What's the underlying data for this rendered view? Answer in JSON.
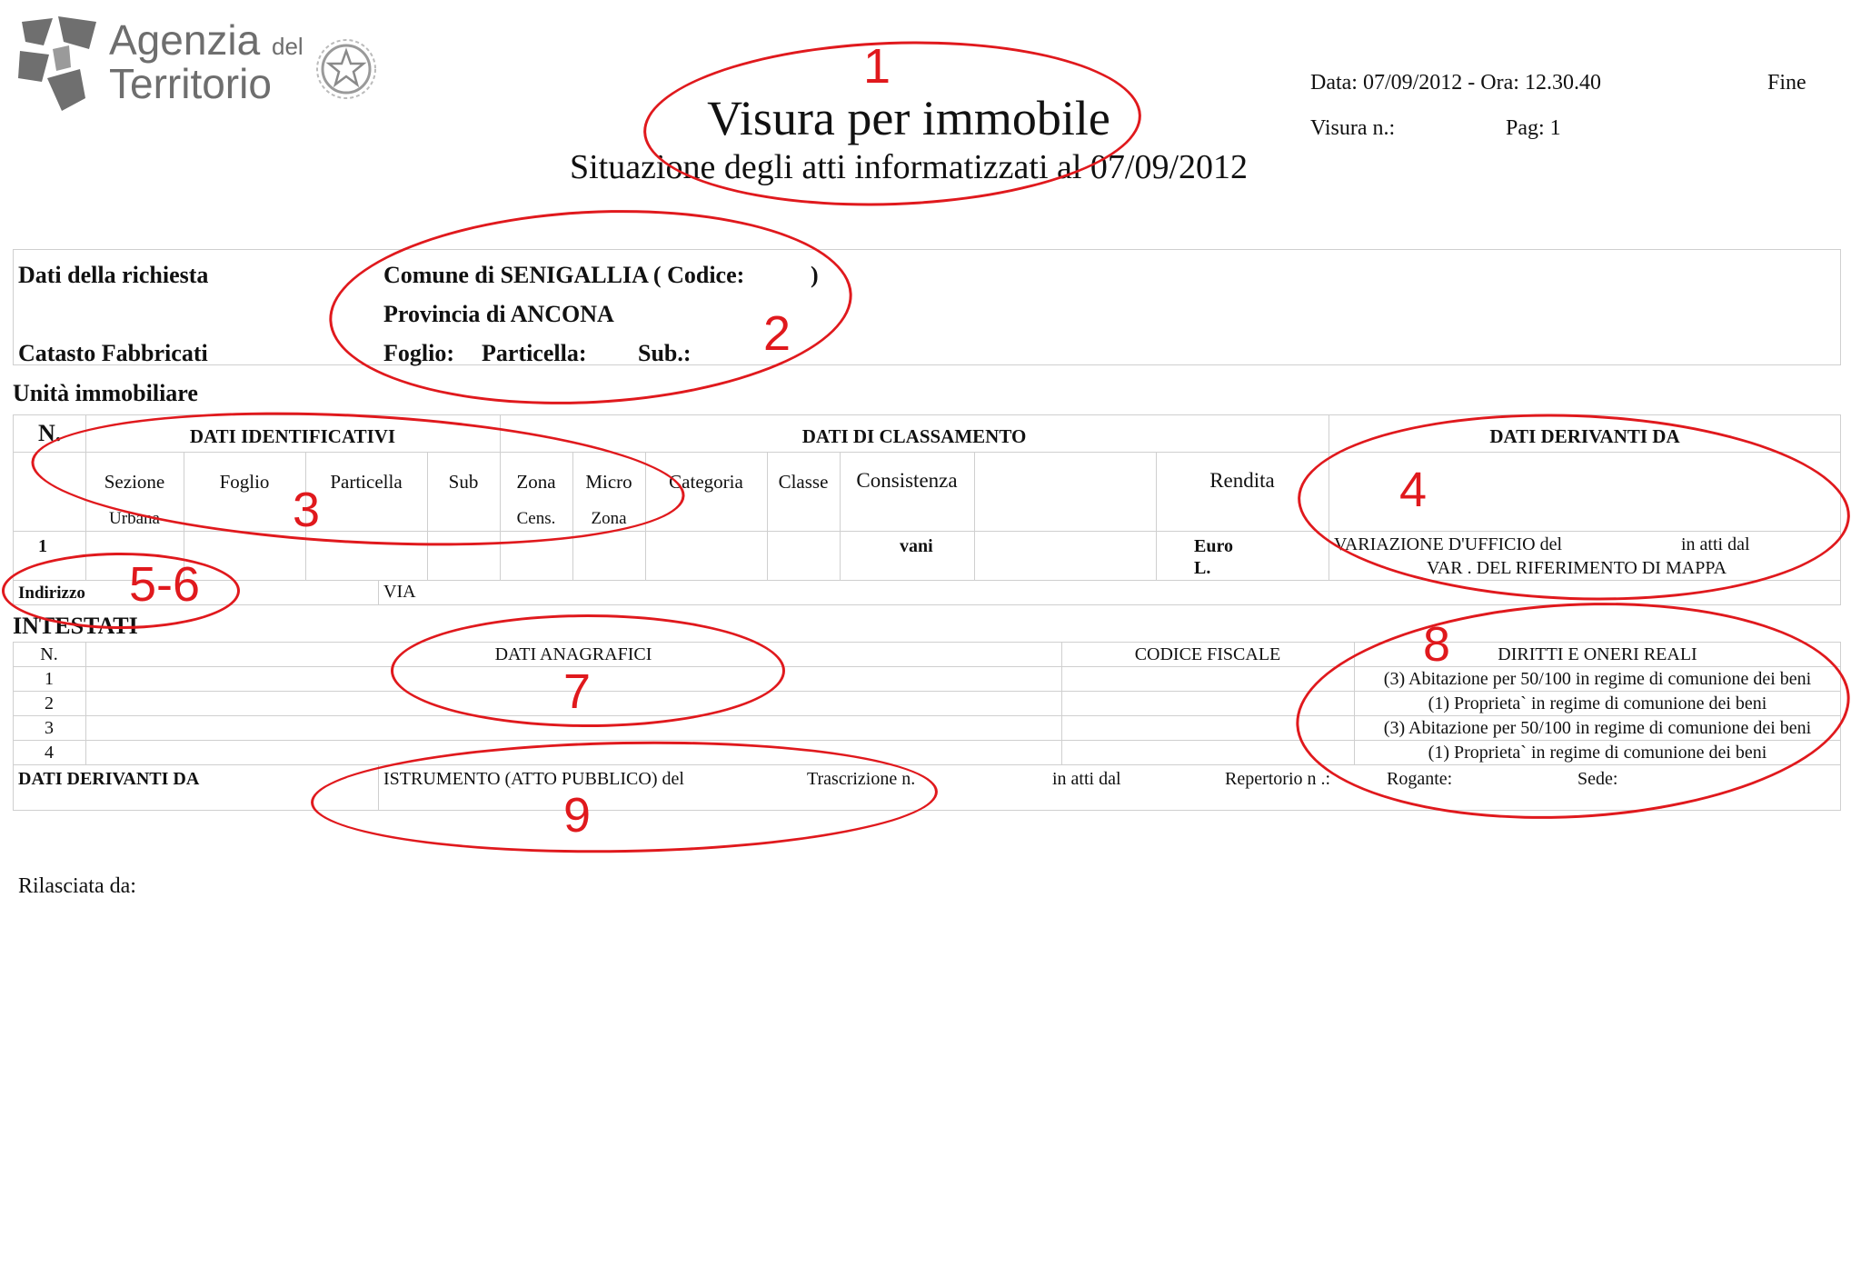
{
  "header": {
    "brand_line1": "Agenzia",
    "brand_del": "del",
    "brand_line2": "Territorio",
    "title": "Visura per immobile",
    "subtitle": "Situazione degli atti informatizzati al 07/09/2012",
    "date_line": "Data: 07/09/2012 - Ora: 12.30.40",
    "fine": "Fine",
    "visura_label": "Visura n.:",
    "pag_label": "Pag: 1"
  },
  "richiesta": {
    "label": "Dati della richiesta",
    "catasto": "Catasto Fabbricati",
    "comune": "Comune di SENIGALLIA ( Codice:",
    "comune_close": ")",
    "provincia": "Provincia di ANCONA",
    "foglio": "Foglio:",
    "particella": "Particella:",
    "sub": "Sub.:"
  },
  "unita": {
    "title": "Unità immobiliare",
    "n_header": "N.",
    "dati_identificativi": "DATI IDENTIFICATIVI",
    "dati_classamento": "DATI DI CLASSAMENTO",
    "dati_derivanti": "DATI DERIVANTI DA",
    "sezione": "Sezione",
    "urbana": "Urbana",
    "foglio": "Foglio",
    "particella": "Particella",
    "sub": "Sub",
    "zona": "Zona",
    "cens": "Cens.",
    "micro": "Micro",
    "micro_zona": "Zona",
    "categoria": "Categoria",
    "classe": "Classe",
    "consistenza": "Consistenza",
    "rendita": "Rendita",
    "row_n": "1",
    "vani": "vani",
    "euro": "Euro",
    "lire": "L.",
    "variazione": "VARIAZIONE D'UFFICIO del",
    "in_atti_dal": "in atti dal",
    "var_rif": "VAR . DEL RIFERIMENTO DI MAPPA",
    "indirizzo": "Indirizzo",
    "via": "VIA"
  },
  "intestati": {
    "title": "INTESTATI",
    "n_header": "N.",
    "anagrafici": "DATI ANAGRAFICI",
    "codice_fiscale": "CODICE FISCALE",
    "diritti": "DIRITTI E ONERI REALI",
    "rows": [
      {
        "n": "1",
        "diritto": "(3) Abitazione per 50/100 in regime di comunione dei beni"
      },
      {
        "n": "2",
        "diritto": "(1) Proprieta` in regime di comunione dei beni"
      },
      {
        "n": "3",
        "diritto": "(3) Abitazione per 50/100 in regime di comunione dei beni"
      },
      {
        "n": "4",
        "diritto": "(1) Proprieta` in regime di comunione dei beni"
      }
    ],
    "derivanti_label": "DATI DERIVANTI DA",
    "istrumento": "ISTRUMENTO (ATTO PUBBLICO) del",
    "trascrizione": "Trascrizione n.",
    "in_atti_dal": "in atti dal",
    "repertorio": "Repertorio n .:",
    "rogante": "Rogante:",
    "sede": "Sede:"
  },
  "footer": {
    "rilasciata": "Rilasciata da:"
  },
  "annotations": {
    "color": "#e0191d",
    "labels": [
      "1",
      "2",
      "3",
      "4",
      "5-6",
      "7",
      "8",
      "9"
    ]
  }
}
